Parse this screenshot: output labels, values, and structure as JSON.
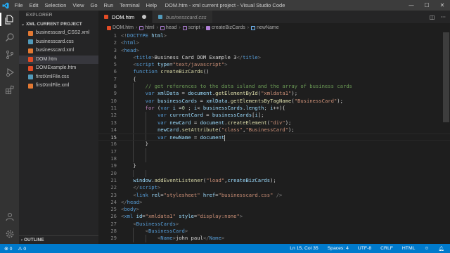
{
  "window": {
    "title": "DOM.htm - xml current project - Visual Studio Code",
    "menu": [
      "File",
      "Edit",
      "Selection",
      "View",
      "Go",
      "Run",
      "Terminal",
      "Help"
    ],
    "controls": {
      "minimize": "—",
      "maximize": "☐",
      "close": "✕"
    }
  },
  "sidebar": {
    "header": "EXPLORER",
    "section": "XML CURRENT PROJECT",
    "files": [
      {
        "name": "businesscard_CSS2.xml",
        "type": "xml",
        "color": "#e37933"
      },
      {
        "name": "businesscard.css",
        "type": "css",
        "color": "#519aba"
      },
      {
        "name": "businesscard.xml",
        "type": "xml",
        "color": "#e37933"
      },
      {
        "name": "DOM.htm",
        "type": "html",
        "color": "#e34c26",
        "selected": true
      },
      {
        "name": "DOMExample.htm",
        "type": "html",
        "color": "#e34c26"
      },
      {
        "name": "firstXmlFile.css",
        "type": "css",
        "color": "#519aba"
      },
      {
        "name": "firstXmlFile.xml",
        "type": "xml",
        "color": "#e37933"
      }
    ],
    "outline": "OUTLINE"
  },
  "tabs": [
    {
      "label": "DOM.htm",
      "active": true,
      "modified": true
    },
    {
      "label": "businesscard.css",
      "active": false,
      "italic": true
    }
  ],
  "breadcrumbs": [
    "DOM.htm",
    "html",
    "head",
    "script",
    "createBizCards",
    "newName"
  ],
  "code": {
    "start_line": 1,
    "current_line": 15,
    "lines": [
      [
        [
          "t-br",
          "<!"
        ],
        [
          "t-tag",
          "DOCTYPE"
        ],
        [
          "t-attr",
          " html"
        ],
        [
          "t-br",
          ">"
        ]
      ],
      [
        [
          "t-br",
          "<"
        ],
        [
          "t-tag",
          "html"
        ],
        [
          "t-br",
          ">"
        ]
      ],
      [
        [
          "t-br",
          "<"
        ],
        [
          "t-tag",
          "head"
        ],
        [
          "t-br",
          ">"
        ]
      ],
      [
        [
          "t-txt",
          "    "
        ],
        [
          "t-br",
          "<"
        ],
        [
          "t-tag",
          "title"
        ],
        [
          "t-br",
          ">"
        ],
        [
          "t-txt",
          "Business Card DOM Example 3"
        ],
        [
          "t-br",
          "</"
        ],
        [
          "t-tag",
          "title"
        ],
        [
          "t-br",
          ">"
        ]
      ],
      [
        [
          "t-txt",
          "    "
        ],
        [
          "t-br",
          "<"
        ],
        [
          "t-tag",
          "script"
        ],
        [
          "t-attr",
          " type"
        ],
        [
          "t-txt",
          "="
        ],
        [
          "t-str",
          "\"text/javascript\""
        ],
        [
          "t-br",
          ">"
        ]
      ],
      [
        [
          "t-txt",
          "    "
        ],
        [
          "t-kw",
          "function"
        ],
        [
          "t-txt",
          " "
        ],
        [
          "t-fn",
          "createBizCards"
        ],
        [
          "t-txt",
          "()"
        ]
      ],
      [
        [
          "t-txt",
          "    {"
        ]
      ],
      [
        [
          "t-txt",
          "        "
        ],
        [
          "t-cm",
          "// get references to the data island and the array of business cards"
        ]
      ],
      [
        [
          "t-txt",
          "        "
        ],
        [
          "t-kw",
          "var"
        ],
        [
          "t-txt",
          " "
        ],
        [
          "t-var",
          "xmlData"
        ],
        [
          "t-txt",
          " = "
        ],
        [
          "t-var",
          "document"
        ],
        [
          "t-txt",
          "."
        ],
        [
          "t-fn",
          "getElementById"
        ],
        [
          "t-txt",
          "("
        ],
        [
          "t-str",
          "\"xmldata1\""
        ],
        [
          "t-txt",
          ");"
        ]
      ],
      [
        [
          "t-txt",
          "        "
        ],
        [
          "t-kw",
          "var"
        ],
        [
          "t-txt",
          " "
        ],
        [
          "t-var",
          "businessCards"
        ],
        [
          "t-txt",
          " = "
        ],
        [
          "t-var",
          "xmlData"
        ],
        [
          "t-txt",
          "."
        ],
        [
          "t-fn",
          "getElementsByTagName"
        ],
        [
          "t-txt",
          "("
        ],
        [
          "t-str",
          "\"BusinessCard\""
        ],
        [
          "t-txt",
          ");"
        ]
      ],
      [
        [
          "t-txt",
          "        "
        ],
        [
          "t-ctl",
          "for"
        ],
        [
          "t-txt",
          " ("
        ],
        [
          "t-kw",
          "var"
        ],
        [
          "t-txt",
          " "
        ],
        [
          "t-var",
          "i"
        ],
        [
          "t-txt",
          " ="
        ],
        [
          "t-num",
          "0"
        ],
        [
          "t-txt",
          " ; "
        ],
        [
          "t-var",
          "i"
        ],
        [
          "t-txt",
          "< "
        ],
        [
          "t-var",
          "businessCards"
        ],
        [
          "t-txt",
          "."
        ],
        [
          "t-var",
          "length"
        ],
        [
          "t-txt",
          "; "
        ],
        [
          "t-var",
          "i"
        ],
        [
          "t-txt",
          "++){"
        ]
      ],
      [
        [
          "t-txt",
          "            "
        ],
        [
          "t-kw",
          "var"
        ],
        [
          "t-txt",
          " "
        ],
        [
          "t-var",
          "currentCard"
        ],
        [
          "t-txt",
          " = "
        ],
        [
          "t-var",
          "businessCards"
        ],
        [
          "t-txt",
          "["
        ],
        [
          "t-var",
          "i"
        ],
        [
          "t-txt",
          "];"
        ]
      ],
      [
        [
          "t-txt",
          "            "
        ],
        [
          "t-kw",
          "var"
        ],
        [
          "t-txt",
          " "
        ],
        [
          "t-var",
          "newCard"
        ],
        [
          "t-txt",
          " = "
        ],
        [
          "t-var",
          "document"
        ],
        [
          "t-txt",
          "."
        ],
        [
          "t-fn",
          "createElement"
        ],
        [
          "t-txt",
          "("
        ],
        [
          "t-str",
          "\"div\""
        ],
        [
          "t-txt",
          ");"
        ]
      ],
      [
        [
          "t-txt",
          "            "
        ],
        [
          "t-var",
          "newCard"
        ],
        [
          "t-txt",
          "."
        ],
        [
          "t-fn",
          "setAttribute"
        ],
        [
          "t-txt",
          "("
        ],
        [
          "t-str",
          "\"class\""
        ],
        [
          "t-txt",
          ","
        ],
        [
          "t-str",
          "\"BusinessCard\""
        ],
        [
          "t-txt",
          ");"
        ]
      ],
      [
        [
          "t-txt",
          "            "
        ],
        [
          "t-kw",
          "var"
        ],
        [
          "t-txt",
          " "
        ],
        [
          "t-var",
          "newName"
        ],
        [
          "t-txt",
          " = "
        ],
        [
          "t-var",
          "document"
        ]
      ],
      [
        [
          "t-txt",
          "        }"
        ]
      ],
      [
        [
          "t-txt",
          ""
        ]
      ],
      [
        [
          "t-txt",
          ""
        ]
      ],
      [
        [
          "t-txt",
          "    }"
        ]
      ],
      [
        [
          "t-txt",
          ""
        ]
      ],
      [
        [
          "t-txt",
          "    "
        ],
        [
          "t-var",
          "window"
        ],
        [
          "t-txt",
          "."
        ],
        [
          "t-fn",
          "addEventListener"
        ],
        [
          "t-txt",
          "("
        ],
        [
          "t-str",
          "\"load\""
        ],
        [
          "t-txt",
          ","
        ],
        [
          "t-var",
          "createBizCards"
        ],
        [
          "t-txt",
          ");"
        ]
      ],
      [
        [
          "t-txt",
          "    "
        ],
        [
          "t-br",
          "</"
        ],
        [
          "t-tag",
          "script"
        ],
        [
          "t-br",
          ">"
        ]
      ],
      [
        [
          "t-txt",
          "    "
        ],
        [
          "t-br",
          "<"
        ],
        [
          "t-tag",
          "link"
        ],
        [
          "t-attr",
          " rel"
        ],
        [
          "t-txt",
          "="
        ],
        [
          "t-str",
          "\"stylesheet\""
        ],
        [
          "t-attr",
          " href"
        ],
        [
          "t-txt",
          "="
        ],
        [
          "t-str",
          "\"businesscard.css\""
        ],
        [
          "t-txt",
          " "
        ],
        [
          "t-br",
          "/>"
        ]
      ],
      [
        [
          "t-br",
          "</"
        ],
        [
          "t-tag",
          "head"
        ],
        [
          "t-br",
          ">"
        ]
      ],
      [
        [
          "t-br",
          "<"
        ],
        [
          "t-tag",
          "body"
        ],
        [
          "t-br",
          ">"
        ]
      ],
      [
        [
          "t-br",
          "<"
        ],
        [
          "t-tag",
          "xml"
        ],
        [
          "t-attr",
          " id"
        ],
        [
          "t-txt",
          "="
        ],
        [
          "t-str",
          "\"xmldata1\""
        ],
        [
          "t-attr",
          " style"
        ],
        [
          "t-txt",
          "="
        ],
        [
          "t-str",
          "\"display:none\""
        ],
        [
          "t-br",
          ">"
        ]
      ],
      [
        [
          "t-txt",
          "    "
        ],
        [
          "t-br",
          "<"
        ],
        [
          "t-tag",
          "BusinessCards"
        ],
        [
          "t-br",
          ">"
        ]
      ],
      [
        [
          "t-txt",
          "        "
        ],
        [
          "t-br",
          "<"
        ],
        [
          "t-tag",
          "BusinessCard"
        ],
        [
          "t-br",
          ">"
        ]
      ],
      [
        [
          "t-txt",
          "            "
        ],
        [
          "t-br",
          "<"
        ],
        [
          "t-tag",
          "Name"
        ],
        [
          "t-br",
          ">"
        ],
        [
          "t-txt",
          "john paul"
        ],
        [
          "t-br",
          "</"
        ],
        [
          "t-tag",
          "Name"
        ],
        [
          "t-br",
          ">"
        ]
      ]
    ]
  },
  "status": {
    "errors": "⊗ 0",
    "warnings": "⚠ 0",
    "position": "Ln 15, Col 35",
    "indent": "Spaces: 4",
    "encoding": "UTF-8",
    "eol": "CRLF",
    "language": "HTML",
    "feedback_icon": "smiley-icon",
    "bell_icon": "bell-icon"
  }
}
